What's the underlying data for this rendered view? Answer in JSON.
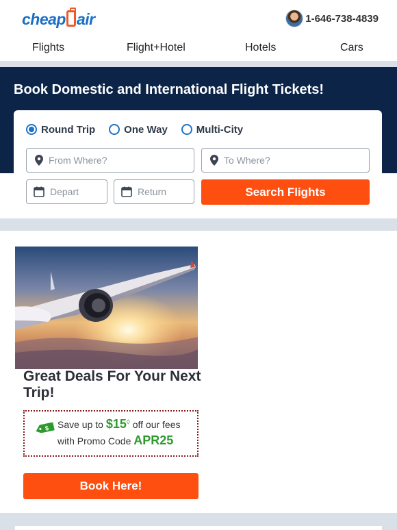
{
  "brand": {
    "logo_left": "cheap",
    "logo_right": "air",
    "accent": "#f05a28",
    "blue": "#1a6fc4"
  },
  "header": {
    "phone": "1-646-738-4839",
    "avatar_icon": "agent-avatar-icon"
  },
  "nav": {
    "flights": "Flights",
    "flight_hotel": "Flight+Hotel",
    "hotels": "Hotels",
    "cars": "Cars"
  },
  "hero": {
    "title": "Book Domestic and International Flight Tickets!",
    "background": "#0c2448"
  },
  "search": {
    "trip_types": [
      {
        "label": "Round Trip",
        "selected": true
      },
      {
        "label": "One Way",
        "selected": false
      },
      {
        "label": "Multi-City",
        "selected": false
      }
    ],
    "from_placeholder": "From Where?",
    "to_placeholder": "To Where?",
    "depart_placeholder": "Depart",
    "return_placeholder": "Return",
    "button_label": "Search Flights",
    "button_color": "#ff4f10"
  },
  "deal": {
    "title": "Great Deals For Your Next Trip!",
    "promo_prefix": "Save up to",
    "promo_amount": "$15",
    "promo_mark": "◊",
    "promo_suffix": "off our fees",
    "promo_code_prefix": "with Promo Code",
    "promo_code": "APR25",
    "tag_icon_text": "$",
    "button_label": "Book Here!"
  }
}
